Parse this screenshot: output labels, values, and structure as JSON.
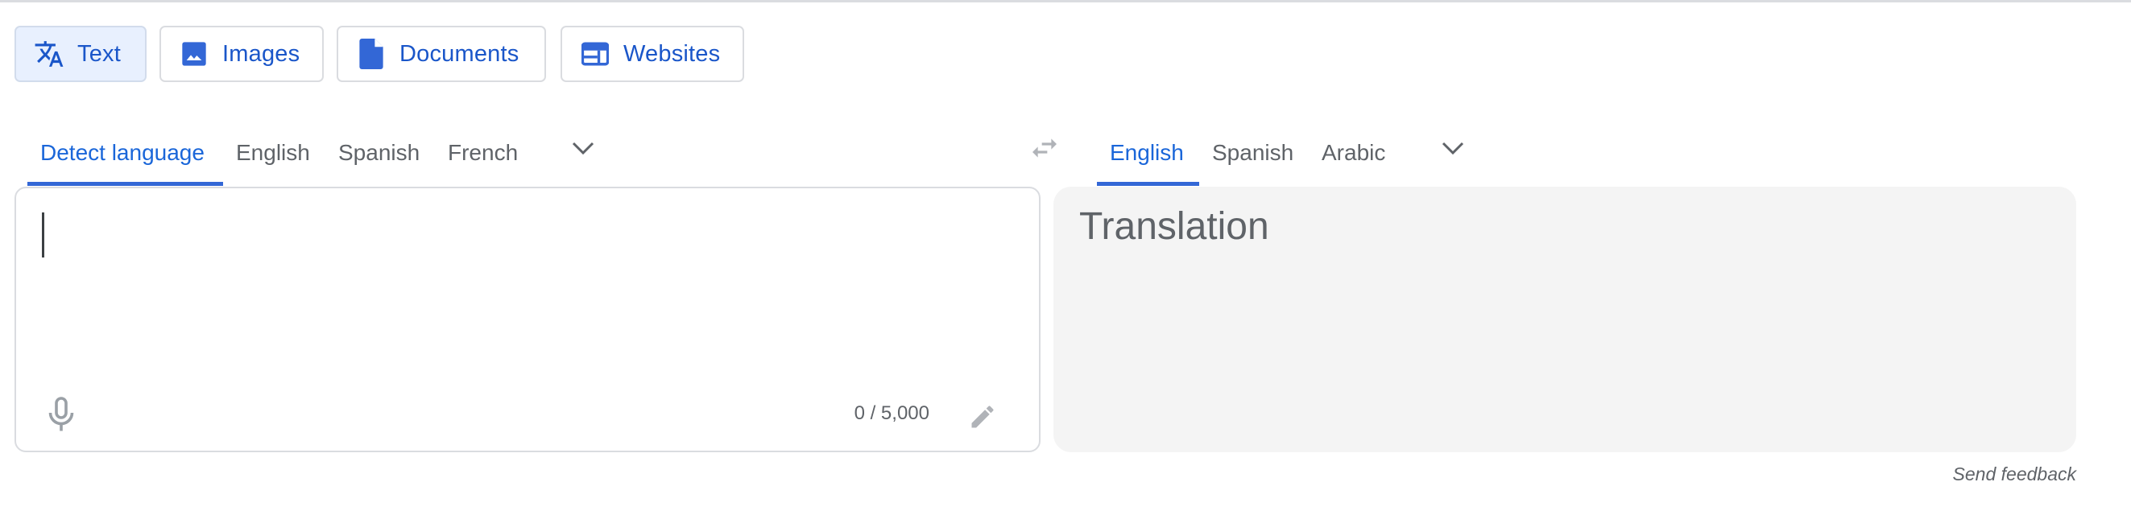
{
  "modes": [
    {
      "label": "Text",
      "icon": "translate-icon",
      "active": true
    },
    {
      "label": "Images",
      "icon": "image-icon",
      "active": false
    },
    {
      "label": "Documents",
      "icon": "document-icon",
      "active": false
    },
    {
      "label": "Websites",
      "icon": "website-icon",
      "active": false
    }
  ],
  "source_languages": [
    {
      "label": "Detect language",
      "active": true
    },
    {
      "label": "English",
      "active": false
    },
    {
      "label": "Spanish",
      "active": false
    },
    {
      "label": "French",
      "active": false
    }
  ],
  "target_languages": [
    {
      "label": "English",
      "active": true
    },
    {
      "label": "Spanish",
      "active": false
    },
    {
      "label": "Arabic",
      "active": false
    }
  ],
  "source": {
    "value": "",
    "char_count": "0 / 5,000"
  },
  "target": {
    "placeholder": "Translation"
  },
  "footer": {
    "feedback_label": "Send feedback"
  },
  "colors": {
    "accent": "#1a73e8",
    "active_mode_bg": "#e8f0fe",
    "target_bg": "#f4f4f4"
  }
}
